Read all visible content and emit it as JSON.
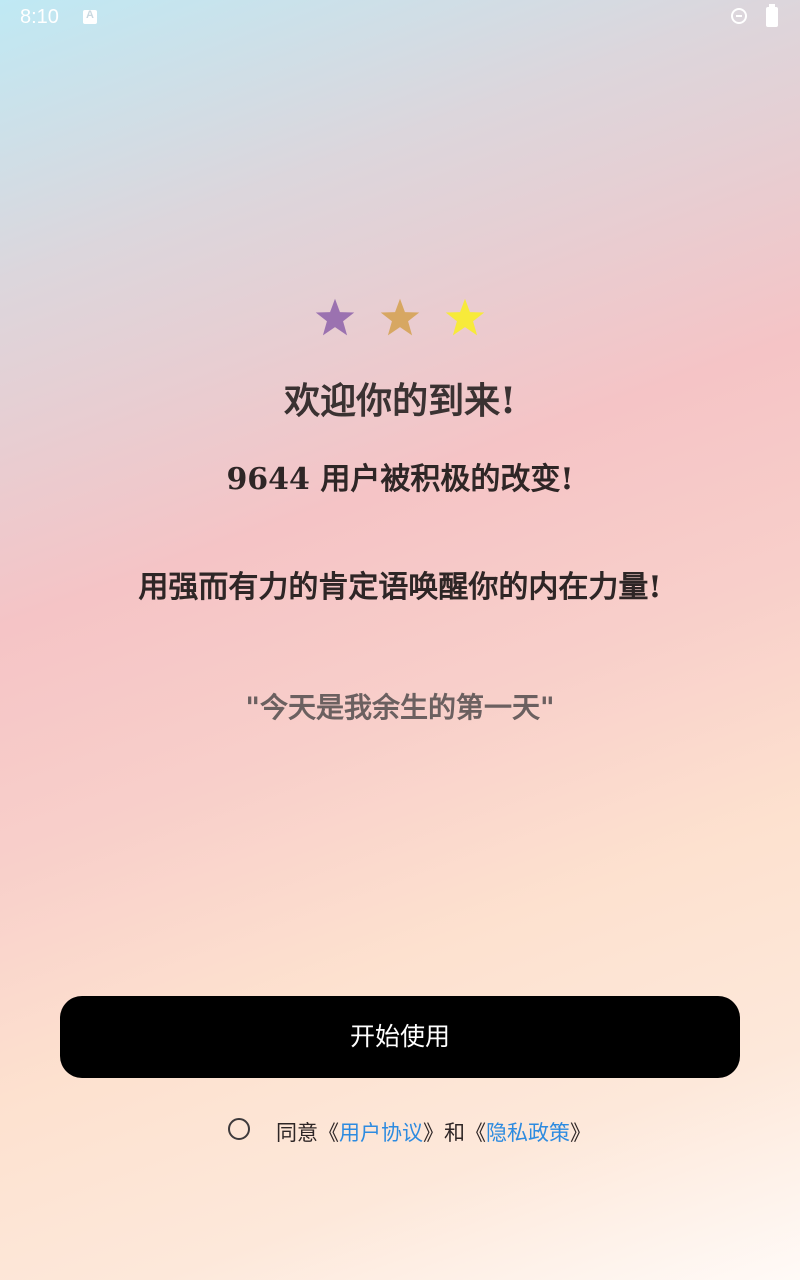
{
  "status_bar": {
    "time": "8:10",
    "keyboard_icon_letter": "A",
    "icons": [
      "a-icon",
      "dnd-icon",
      "battery-icon"
    ]
  },
  "stars": [
    {
      "icon": "star-icon",
      "color": "#9b72b0"
    },
    {
      "icon": "star-icon",
      "color": "#d7a762"
    },
    {
      "icon": "star-icon",
      "color": "#f7ea3a"
    }
  ],
  "welcome": {
    "title": "欢迎你的到来!",
    "users_line": "9644 用户被积极的改变!",
    "tagline": "用强而有力的肯定语唤醒你的内在力量!",
    "quote": "\"今天是我余生的第一天\""
  },
  "actions": {
    "start_label": "开始使用"
  },
  "agreement": {
    "prefix": "同意",
    "open_bracket_1": "《",
    "user_agreement": "用户协议",
    "close_bracket_1": "》",
    "conjunction": "和",
    "open_bracket_2": "《",
    "privacy_policy": "隐私政策",
    "close_bracket_2": "》",
    "checked": false
  },
  "colors": {
    "button_bg": "#000000",
    "link": "#2d8be0",
    "title_text": "#3a3232",
    "quote_text": "#6b6060"
  }
}
